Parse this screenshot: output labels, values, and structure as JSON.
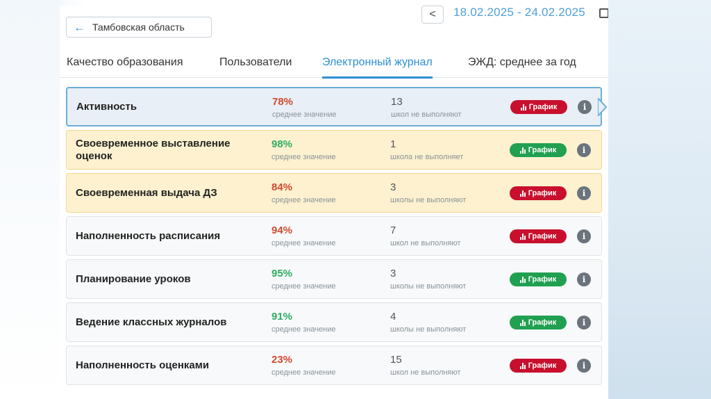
{
  "header": {
    "back_label": "Тамбовская область",
    "prev_label": "<",
    "date_range": "18.02.2025 - 24.02.2025"
  },
  "tabs": [
    {
      "label": "Качество образования",
      "active": false
    },
    {
      "label": "Пользователи",
      "active": false
    },
    {
      "label": "Электронный журнал",
      "active": true
    },
    {
      "label": "ЭЖД: среднее за год",
      "active": false
    }
  ],
  "metrics": [
    {
      "name": "Активность",
      "percent": "78%",
      "percent_color": "red",
      "percent_label": "среднее значение",
      "count": "13",
      "count_label": "школ не выполняют",
      "chart_label": "График",
      "chart_color": "red",
      "state": "selected"
    },
    {
      "name": "Своевременное выставление оценок",
      "percent": "98%",
      "percent_color": "green",
      "percent_label": "среднее значение",
      "count": "1",
      "count_label": "школа не выполняет",
      "chart_label": "График",
      "chart_color": "green",
      "state": "highlight"
    },
    {
      "name": "Своевременная выдача ДЗ",
      "percent": "84%",
      "percent_color": "red",
      "percent_label": "среднее значение",
      "count": "3",
      "count_label": "школы не выполняют",
      "chart_label": "График",
      "chart_color": "red",
      "state": "highlight"
    },
    {
      "name": "Наполненность расписания",
      "percent": "94%",
      "percent_color": "red",
      "percent_label": "среднее значение",
      "count": "7",
      "count_label": "школ не выполняют",
      "chart_label": "График",
      "chart_color": "red",
      "state": "normal"
    },
    {
      "name": "Планирование уроков",
      "percent": "95%",
      "percent_color": "green",
      "percent_label": "среднее значение",
      "count": "3",
      "count_label": "школы не выполняют",
      "chart_label": "График",
      "chart_color": "green",
      "state": "normal"
    },
    {
      "name": "Ведение классных журналов",
      "percent": "91%",
      "percent_color": "green",
      "percent_label": "среднее значение",
      "count": "4",
      "count_label": "школы не выполняют",
      "chart_label": "График",
      "chart_color": "green",
      "state": "normal"
    },
    {
      "name": "Наполненность оценками",
      "percent": "23%",
      "percent_color": "red",
      "percent_label": "среднее значение",
      "count": "15",
      "count_label": "школ не выполняют",
      "chart_label": "График",
      "chart_color": "red",
      "state": "normal"
    }
  ],
  "colors": {
    "accent": "#2c8fd6",
    "red": "#c8102e",
    "green": "#20a050",
    "highlight_bg": "#fdf1cf"
  },
  "icons": {
    "back": "arrow-left-icon",
    "calendar": "calendar-icon",
    "chart": "bar-chart-icon",
    "info": "info-icon"
  }
}
